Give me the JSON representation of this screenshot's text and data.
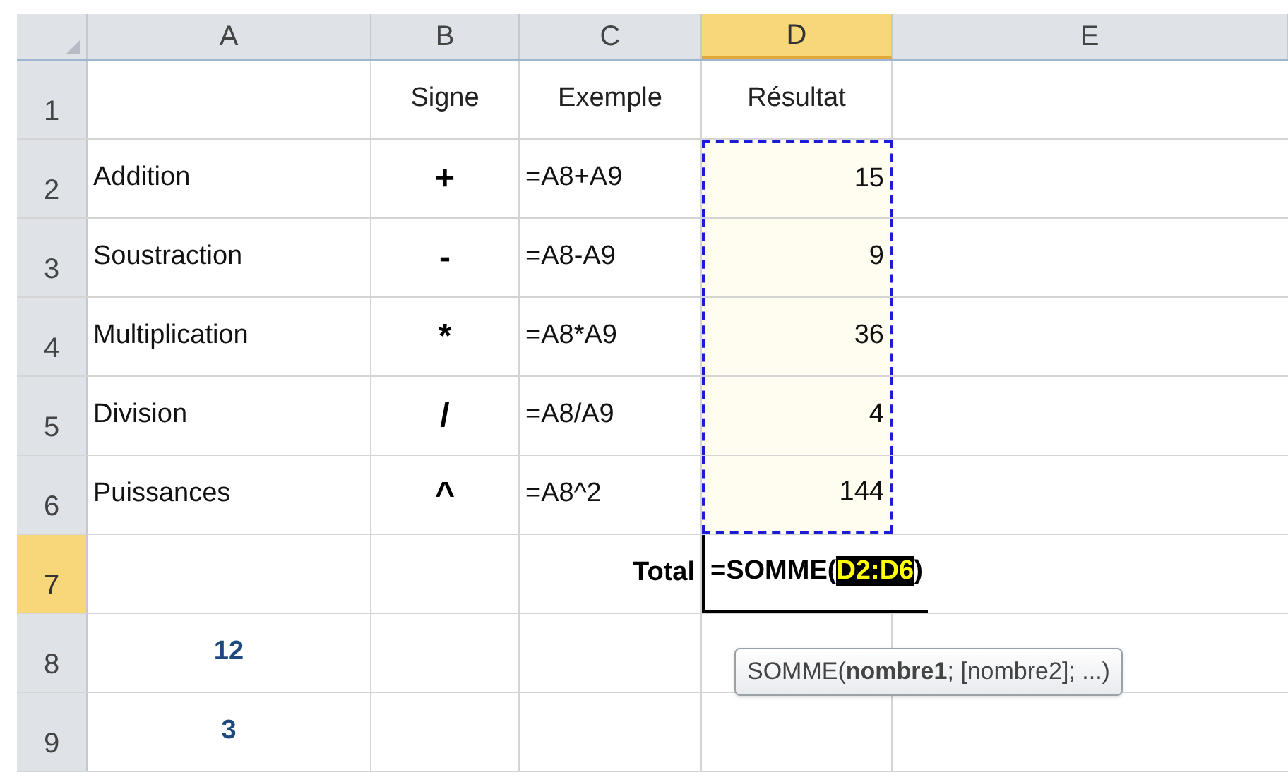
{
  "columns": [
    {
      "label": "A",
      "selected": false
    },
    {
      "label": "B",
      "selected": false
    },
    {
      "label": "C",
      "selected": false
    },
    {
      "label": "D",
      "selected": true
    },
    {
      "label": "E",
      "selected": false
    }
  ],
  "rows": [
    {
      "label": "1",
      "selected": false,
      "kind": "header",
      "b": "Signe",
      "c": "Exemple",
      "d": "Résultat"
    },
    {
      "label": "2",
      "selected": false,
      "kind": "operation",
      "a": "Addition",
      "b": "+",
      "c": "=A8+A9",
      "d": "15",
      "d_in_copy_range": true
    },
    {
      "label": "3",
      "selected": false,
      "kind": "operation",
      "a": "Soustraction",
      "b": "-",
      "c": "=A8-A9",
      "d": "9",
      "d_in_copy_range": true
    },
    {
      "label": "4",
      "selected": false,
      "kind": "operation",
      "a": "Multiplication",
      "b": "*",
      "c": "=A8*A9",
      "d": "36",
      "d_in_copy_range": true
    },
    {
      "label": "5",
      "selected": false,
      "kind": "operation",
      "a": "Division",
      "b": "/",
      "c": "=A8/A9",
      "d": "4",
      "d_in_copy_range": true
    },
    {
      "label": "6",
      "selected": false,
      "kind": "operation",
      "a": "Puissances",
      "b": "^",
      "c": "=A8^2",
      "d": "144",
      "d_in_copy_range": true
    },
    {
      "label": "7",
      "selected": true,
      "kind": "total",
      "c": "Total",
      "editing": {
        "before": "=SOMME(",
        "ref": "D2:D6",
        "after": ")"
      }
    },
    {
      "label": "8",
      "selected": false,
      "kind": "input",
      "a": "12"
    },
    {
      "label": "9",
      "selected": false,
      "kind": "input",
      "a": "3"
    }
  ],
  "tooltip": "SOMME(**nombre1**; [nombre2]; ...)"
}
